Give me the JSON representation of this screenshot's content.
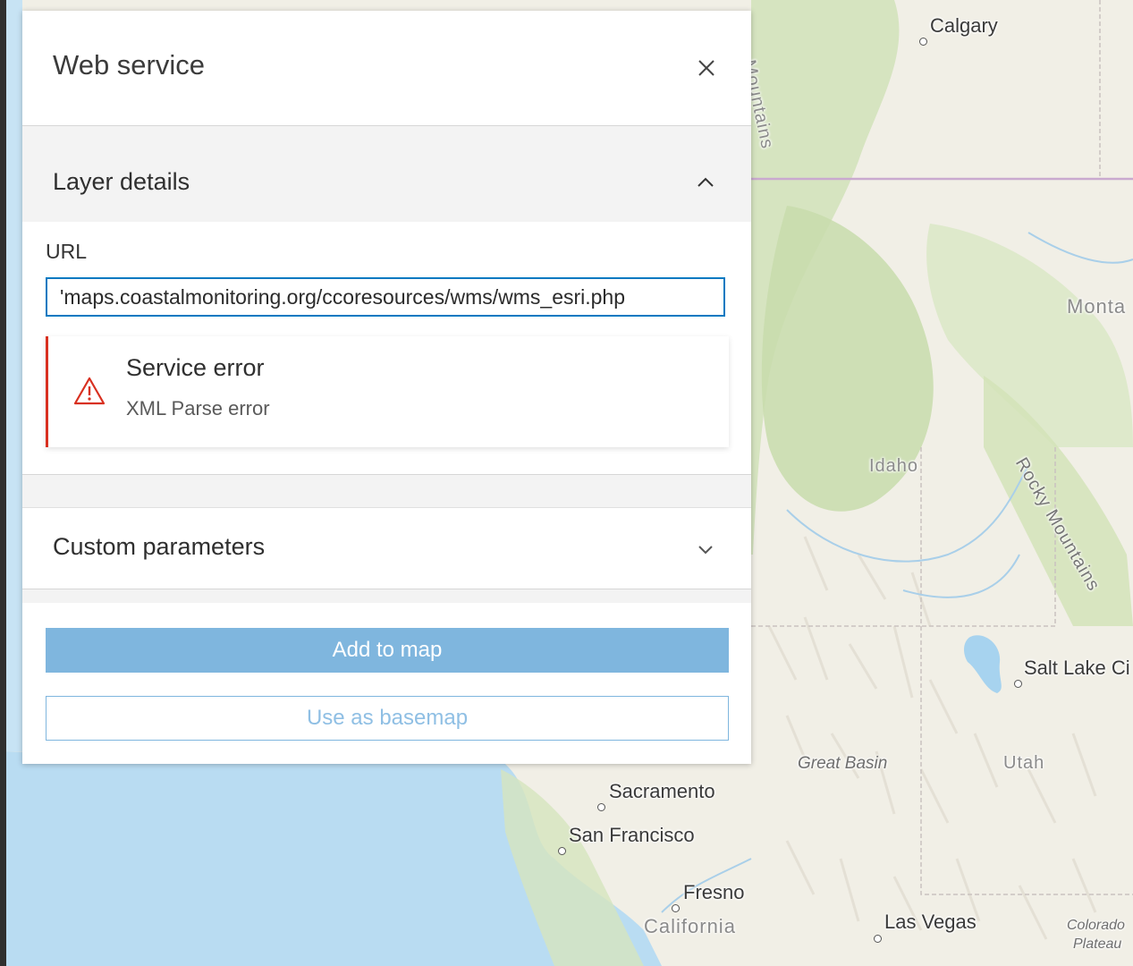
{
  "panel": {
    "title": "Web service",
    "layer_details": {
      "heading": "Layer details",
      "url_label": "URL",
      "url_value": "'maps.coastalmonitoring.org/ccoresources/wms/wms_esri.php",
      "error": {
        "title": "Service error",
        "message": "XML Parse error"
      }
    },
    "custom_parameters": {
      "heading": "Custom parameters"
    },
    "buttons": {
      "add_to_map": "Add to map",
      "use_as_basemap": "Use as basemap"
    }
  },
  "map": {
    "labels": {
      "calgary": "Calgary",
      "mountains": "Mountains",
      "montana": "Monta",
      "idaho": "Idaho",
      "rocky_mountains": "Rocky Mountains",
      "salt_lake_city": "Salt Lake Ci",
      "great_basin": "Great Basin",
      "utah": "Utah",
      "sacramento": "Sacramento",
      "san_francisco": "San Francisco",
      "fresno": "Fresno",
      "california": "California",
      "las_vegas": "Las Vegas",
      "colorado": "Colorado",
      "plateau": "Plateau"
    }
  },
  "colors": {
    "accent": "#0079c1",
    "error": "#d83020",
    "button_disabled": "#7fb6de",
    "ocean": "#b6dcf3",
    "land": "#f2f0e8",
    "forest": "#cfe0b4"
  }
}
